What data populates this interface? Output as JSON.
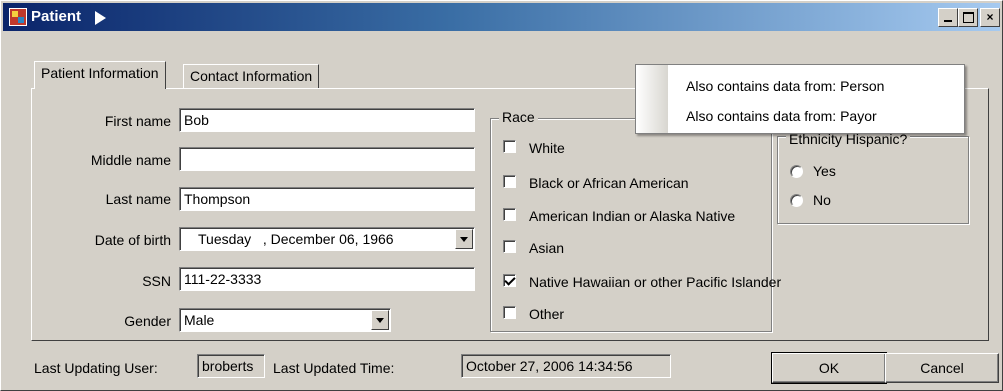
{
  "window": {
    "title": "Patient",
    "controls": {
      "minimize": "",
      "maximize": "",
      "close": "×"
    }
  },
  "tabs": [
    {
      "label": "Patient Information",
      "active": true
    },
    {
      "label": "Contact Information",
      "active": false
    }
  ],
  "form": {
    "first_name": {
      "label": "First name",
      "value": "Bob"
    },
    "middle_name": {
      "label": "Middle name",
      "value": ""
    },
    "last_name": {
      "label": "Last name",
      "value": "Thompson"
    },
    "date_of_birth": {
      "label": "Date of birth",
      "value": "Tuesday   , December 06, 1966"
    },
    "ssn": {
      "label": "SSN",
      "value": "111-22-3333"
    },
    "gender": {
      "label": "Gender",
      "value": "Male"
    }
  },
  "race": {
    "title": "Race",
    "options": [
      {
        "label": "White",
        "checked": false
      },
      {
        "label": "Black or African American",
        "checked": false
      },
      {
        "label": "American Indian or Alaska Native",
        "checked": false
      },
      {
        "label": "Asian",
        "checked": false
      },
      {
        "label": "Native Hawaiian or other Pacific Islander",
        "checked": true
      },
      {
        "label": "Other",
        "checked": false
      }
    ]
  },
  "ethnicity": {
    "title": "Ethnicity Hispanic?",
    "options": [
      {
        "label": "Yes"
      },
      {
        "label": "No"
      }
    ]
  },
  "context_menu": {
    "items": [
      {
        "label": "Also contains data from: Person"
      },
      {
        "label": "Also contains data from: Payor"
      }
    ]
  },
  "footer": {
    "last_user_label": "Last Updating User:",
    "last_user_value": "broberts",
    "last_time_label": "Last Updated Time:",
    "last_time_value": "October 27, 2006 14:34:56",
    "ok_label": "OK",
    "cancel_label": "Cancel"
  },
  "colors": {
    "dialog_bg": "#d4d0c8",
    "titlebar_start": "#0a246a",
    "titlebar_end": "#a6caf0"
  }
}
